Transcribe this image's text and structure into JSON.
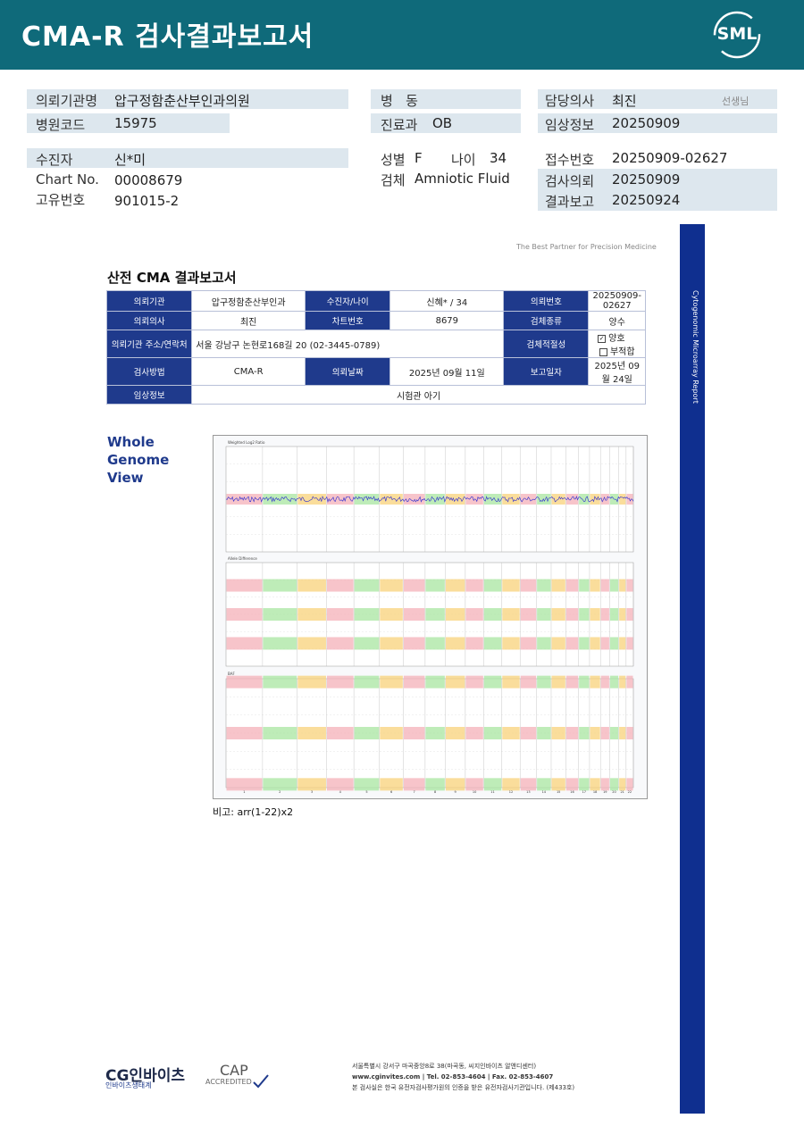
{
  "header": {
    "title": "CMA-R 검사결과보고서",
    "logo": "SML"
  },
  "info": {
    "institution_label": "의뢰기관명",
    "institution": "압구정함춘산부인과의원",
    "hospital_code_label": "병원코드",
    "hospital_code": "15975",
    "ward_label": "병   동",
    "ward": "",
    "dept_label": "진료과",
    "dept": "OB",
    "doctor_label": "담당의사",
    "doctor": "최진",
    "doctor_suffix": "선생님",
    "clinical_label": "임상정보",
    "clinical": "20250909",
    "patient_label": "수진자",
    "patient": "신*미",
    "chart_label": "Chart No.",
    "chart": "00008679",
    "id_label": "고유번호",
    "id": "901015-2",
    "sex_label": "성별",
    "sex": "F",
    "age_label": "나이",
    "age": "34",
    "specimen_label": "검체",
    "specimen": "Amniotic Fluid",
    "receipt_label": "접수번호",
    "receipt": "20250909-02627",
    "request_label": "검사의뢰",
    "request": "20250909",
    "report_label": "결과보고",
    "report": "20250924"
  },
  "side_band": {
    "text": "Cytogenomic Microarray Report"
  },
  "report": {
    "tagline": "The Best Partner for Precision Medicine",
    "title": "산전 CMA 결과보고서",
    "rows": {
      "r1": {
        "h1": "의뢰기관",
        "v1": "압구정함춘산부인과",
        "h2": "수진자/나이",
        "v2": "신혜* / 34",
        "h3": "의뢰번호",
        "v3": "20250909-02627"
      },
      "r2": {
        "h1": "의뢰의사",
        "v1": "최진",
        "h2": "차트번호",
        "v2": "8679",
        "h3": "검체종류",
        "v3": "양수"
      },
      "r3": {
        "h1": "의뢰기관 주소/연락처",
        "v1": "서울 강남구 논현로168길 20 (02-3445-0789)",
        "h3": "검체적절성",
        "ok": "양호",
        "bad": "부적합"
      },
      "r4": {
        "h1": "검사방법",
        "v1": "CMA-R",
        "h2": "의뢰날짜",
        "v2": "2025년 09월 11일",
        "h3": "보고일자",
        "v3": "2025년 09월 24일"
      },
      "r5": {
        "h1": "임상정보",
        "v1": "시험관 아기"
      }
    },
    "wgv_line1": "Whole",
    "wgv_line2": "Genome",
    "wgv_line3": "View",
    "panel1_label": "Weighted Log2 Ratio",
    "panel2_label": "Allele Difference",
    "panel3_label": "BAF",
    "remark_label": "비고:",
    "remark": "arr(1-22)x2"
  },
  "footer": {
    "logo": "CG인바이츠",
    "logo_sub": "인바이츠생태계",
    "cap": "CAP",
    "cap_sub": "ACCREDITED",
    "addr1": "서울특별시 강서구 마곡중앙8로 38(마곡동, 씨지인바이츠 알앤디센터)",
    "addr2": "www.cginvites.com | Tel. 02-853-4604 | Fax. 02-853-4607",
    "addr3": "본 검사실은 한국 유전자검사평가원의 인증을 받은 유전자검사기관입니다. (제433호)"
  }
}
